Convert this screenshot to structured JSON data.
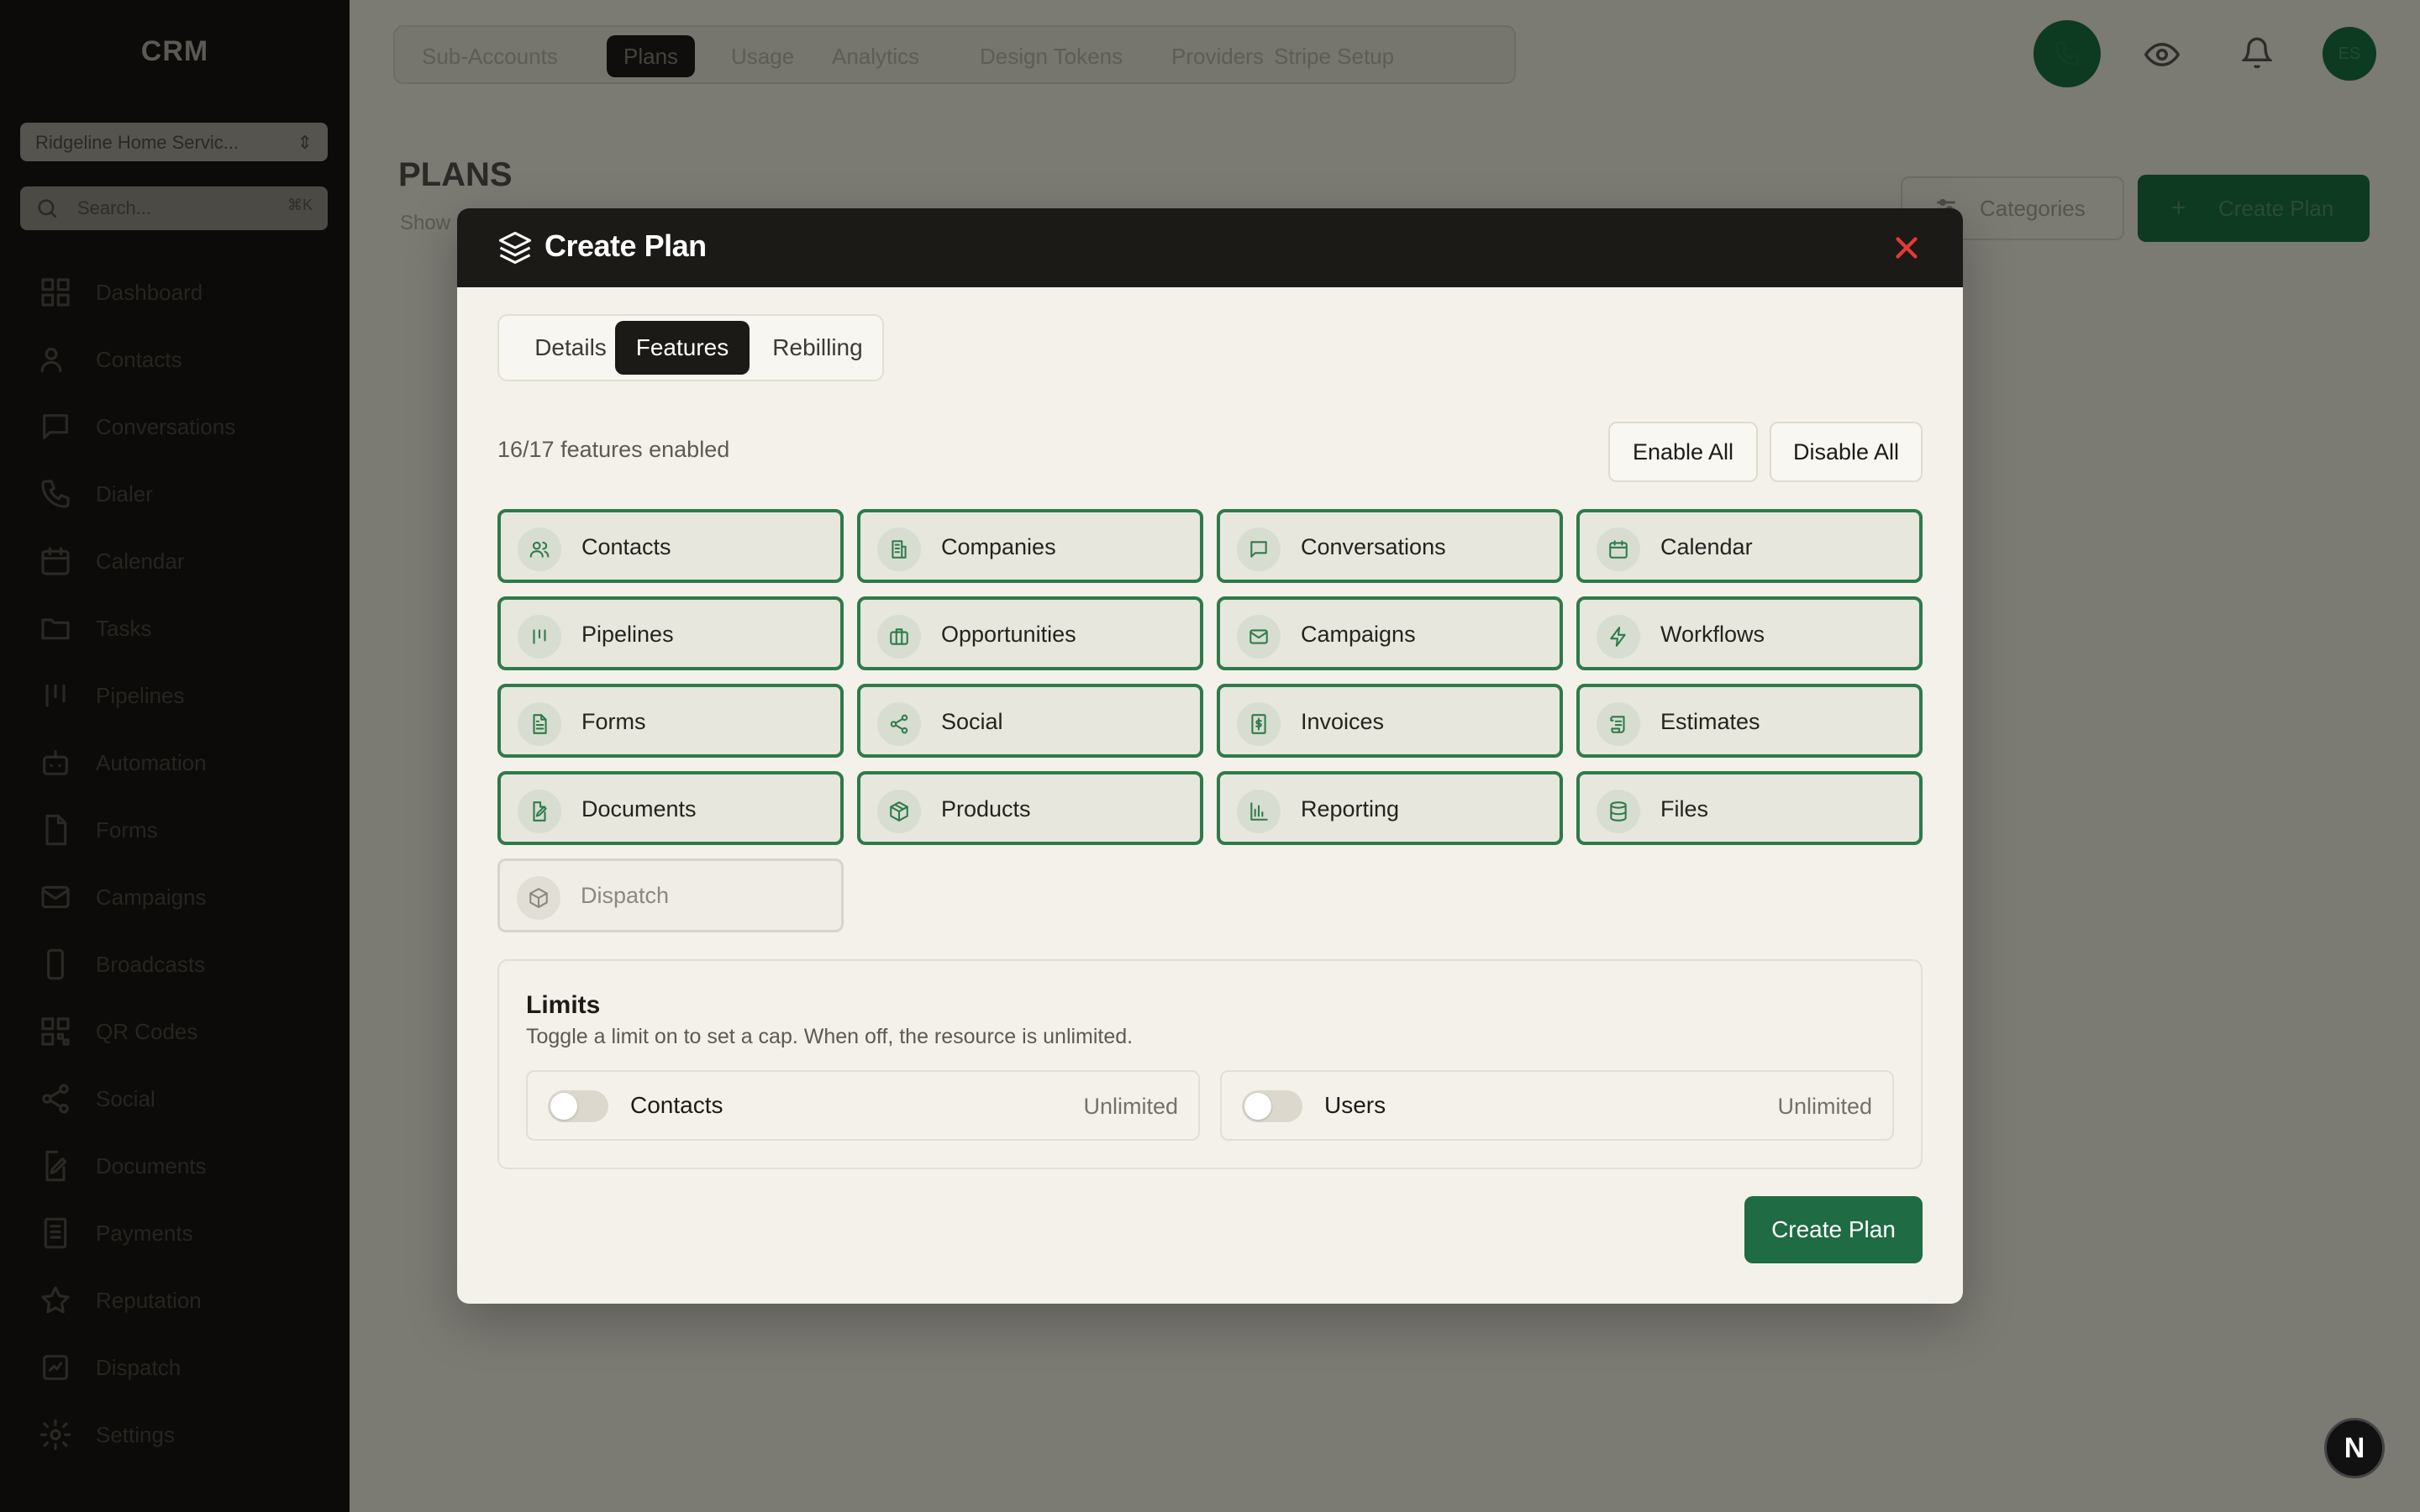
{
  "app": {
    "brand": "CRM",
    "account_select": "Ridgeline Home Servic...",
    "search_placeholder": "Search...",
    "search_shortcut": "⌘K"
  },
  "sidebar": {
    "items": [
      {
        "label": "Dashboard",
        "icon": "dashboard-icon"
      },
      {
        "label": "Contacts",
        "icon": "contacts-icon"
      },
      {
        "label": "Conversations",
        "icon": "chat-icon"
      },
      {
        "label": "Dialer",
        "icon": "phone-icon"
      },
      {
        "label": "Calendar",
        "icon": "calendar-icon"
      },
      {
        "label": "Tasks",
        "icon": "folder-icon"
      },
      {
        "label": "Pipelines",
        "icon": "pipelines-icon"
      },
      {
        "label": "Automation",
        "icon": "automation-icon"
      },
      {
        "label": "Forms",
        "icon": "forms-icon"
      },
      {
        "label": "Campaigns",
        "icon": "mail-icon"
      },
      {
        "label": "Broadcasts",
        "icon": "mobile-icon"
      },
      {
        "label": "QR Codes",
        "icon": "qr-icon"
      },
      {
        "label": "Social",
        "icon": "share-icon"
      },
      {
        "label": "Documents",
        "icon": "document-edit-icon"
      },
      {
        "label": "Payments",
        "icon": "payments-icon"
      },
      {
        "label": "Reputation",
        "icon": "star-icon"
      },
      {
        "label": "Dispatch",
        "icon": "dispatch-icon"
      },
      {
        "label": "Settings",
        "icon": "gear-icon"
      }
    ]
  },
  "topnav": {
    "tabs": [
      "Sub-Accounts",
      "Plans",
      "Usage",
      "Analytics",
      "Design Tokens",
      "Providers",
      "Stripe Setup"
    ],
    "active": "Plans",
    "avatar_initials": "ES"
  },
  "page": {
    "title": "PLANS",
    "subtitle": "Show",
    "categories_label": "Categories",
    "create_label": "Create Plan"
  },
  "modal": {
    "title": "Create Plan",
    "tabs": [
      "Details",
      "Features",
      "Rebilling"
    ],
    "active_tab": "Features",
    "count_label": "16/17 features enabled",
    "enable_all": "Enable All",
    "disable_all": "Disable All",
    "features": [
      {
        "label": "Contacts",
        "icon": "users-icon",
        "enabled": true
      },
      {
        "label": "Companies",
        "icon": "building-icon",
        "enabled": true
      },
      {
        "label": "Conversations",
        "icon": "message-icon",
        "enabled": true
      },
      {
        "label": "Calendar",
        "icon": "calendar-icon",
        "enabled": true
      },
      {
        "label": "Pipelines",
        "icon": "pipeline-icon",
        "enabled": true
      },
      {
        "label": "Opportunities",
        "icon": "briefcase-icon",
        "enabled": true
      },
      {
        "label": "Campaigns",
        "icon": "mail-icon",
        "enabled": true
      },
      {
        "label": "Workflows",
        "icon": "bolt-icon",
        "enabled": true
      },
      {
        "label": "Forms",
        "icon": "file-text-icon",
        "enabled": true
      },
      {
        "label": "Social",
        "icon": "share-icon",
        "enabled": true
      },
      {
        "label": "Invoices",
        "icon": "invoice-icon",
        "enabled": true
      },
      {
        "label": "Estimates",
        "icon": "scroll-icon",
        "enabled": true
      },
      {
        "label": "Documents",
        "icon": "file-edit-icon",
        "enabled": true
      },
      {
        "label": "Products",
        "icon": "package-icon",
        "enabled": true
      },
      {
        "label": "Reporting",
        "icon": "bar-chart-icon",
        "enabled": true
      },
      {
        "label": "Files",
        "icon": "database-icon",
        "enabled": true
      },
      {
        "label": "Dispatch",
        "icon": "box-icon",
        "enabled": false
      }
    ],
    "limits": {
      "title": "Limits",
      "description": "Toggle a limit on to set a cap. When off, the resource is unlimited.",
      "items": [
        {
          "label": "Contacts",
          "value": "Unlimited",
          "enabled": false
        },
        {
          "label": "Users",
          "value": "Unlimited",
          "enabled": false
        }
      ]
    },
    "submit_label": "Create Plan"
  },
  "colors": {
    "accent": "#1f6b44",
    "feature_border": "#2e7a4b",
    "header_bg": "#1c1a17",
    "close": "#e53935"
  }
}
